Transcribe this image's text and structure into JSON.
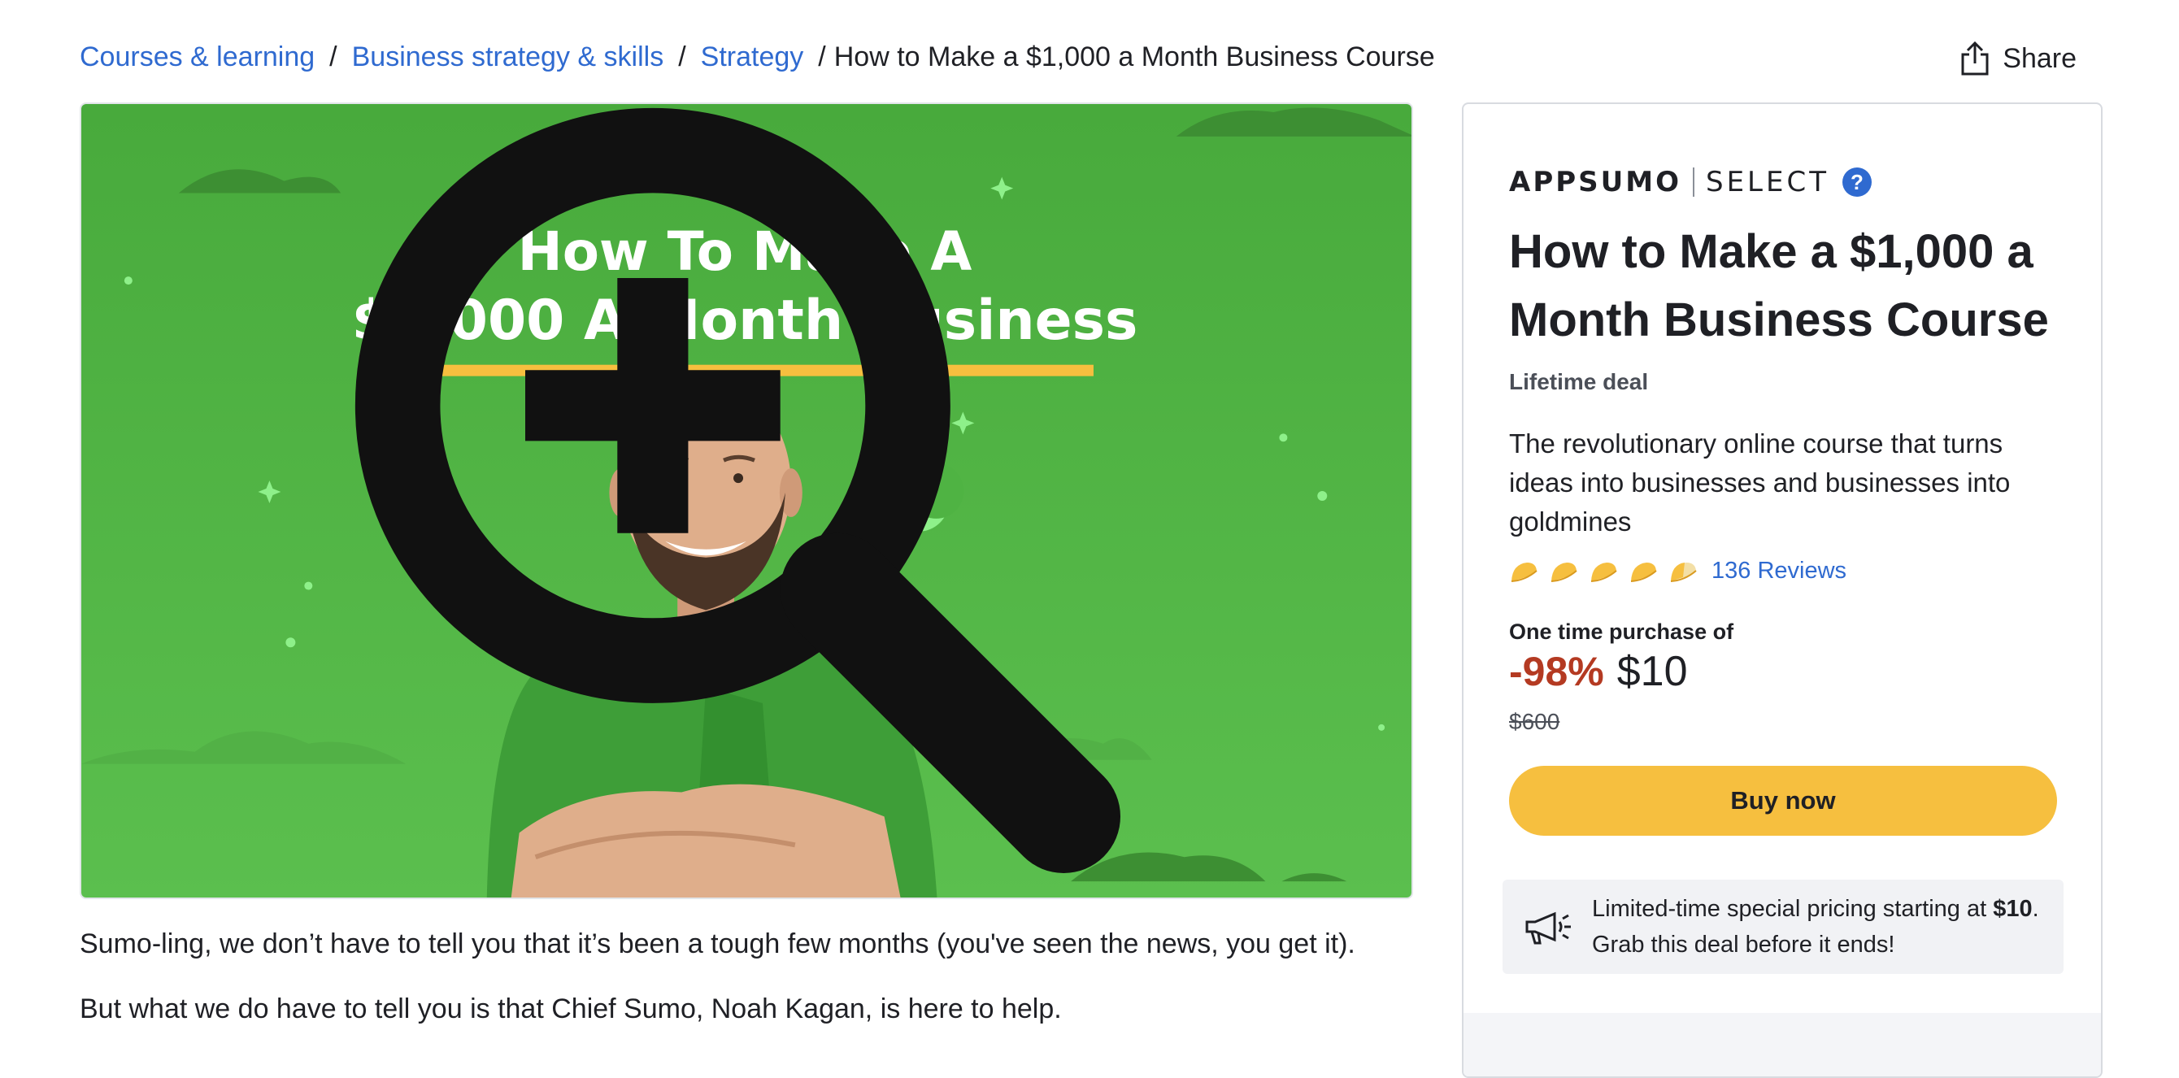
{
  "breadcrumb": {
    "items": [
      "Courses & learning",
      "Business strategy & skills",
      "Strategy"
    ],
    "separator": "/",
    "current": "How to Make a $1,000 a Month Business Course"
  },
  "share": {
    "label": "Share",
    "icon": "share-icon"
  },
  "hero": {
    "headline_line1": "How To Make A",
    "headline_line2": "$1,000 A Month Business",
    "zoom_icon": "zoom-in-icon",
    "colors": {
      "background": "#4caf3e",
      "underline": "#f6bf3f",
      "shirt": "#3e9e38",
      "moon": "#8ef08a"
    }
  },
  "description": {
    "p1": "Sumo-ling, we don’t have to tell you that it’s been a tough few months (you've seen the news, you get it).",
    "p2": "But what we do have to tell you is that Chief Sumo, Noah Kagan, is here to help."
  },
  "card": {
    "brand": "APPSUMO",
    "brand_suffix": "SELECT",
    "help_label": "?",
    "title": "How to Make a $1,000 a Month Business Course",
    "deal_type": "Lifetime deal",
    "tagline": "The revolutionary online course that turns ideas into businesses and businesses into goldmines",
    "rating": {
      "stars": 4.5,
      "max": 5,
      "icon": "taco-icon",
      "reviews_label": "136 Reviews"
    },
    "purchase_label": "One time purchase of",
    "discount": "-98%",
    "price": "$10",
    "original_price": "$600",
    "buy_label": "Buy now",
    "promo": {
      "icon": "megaphone-icon",
      "text_before": "Limited-time special pricing starting at ",
      "text_bold": "$10",
      "text_after": ". Grab this deal before it ends!"
    },
    "colors": {
      "accent": "#f6bf3f",
      "link": "#2f6ad0",
      "discount": "#b43a22"
    }
  }
}
